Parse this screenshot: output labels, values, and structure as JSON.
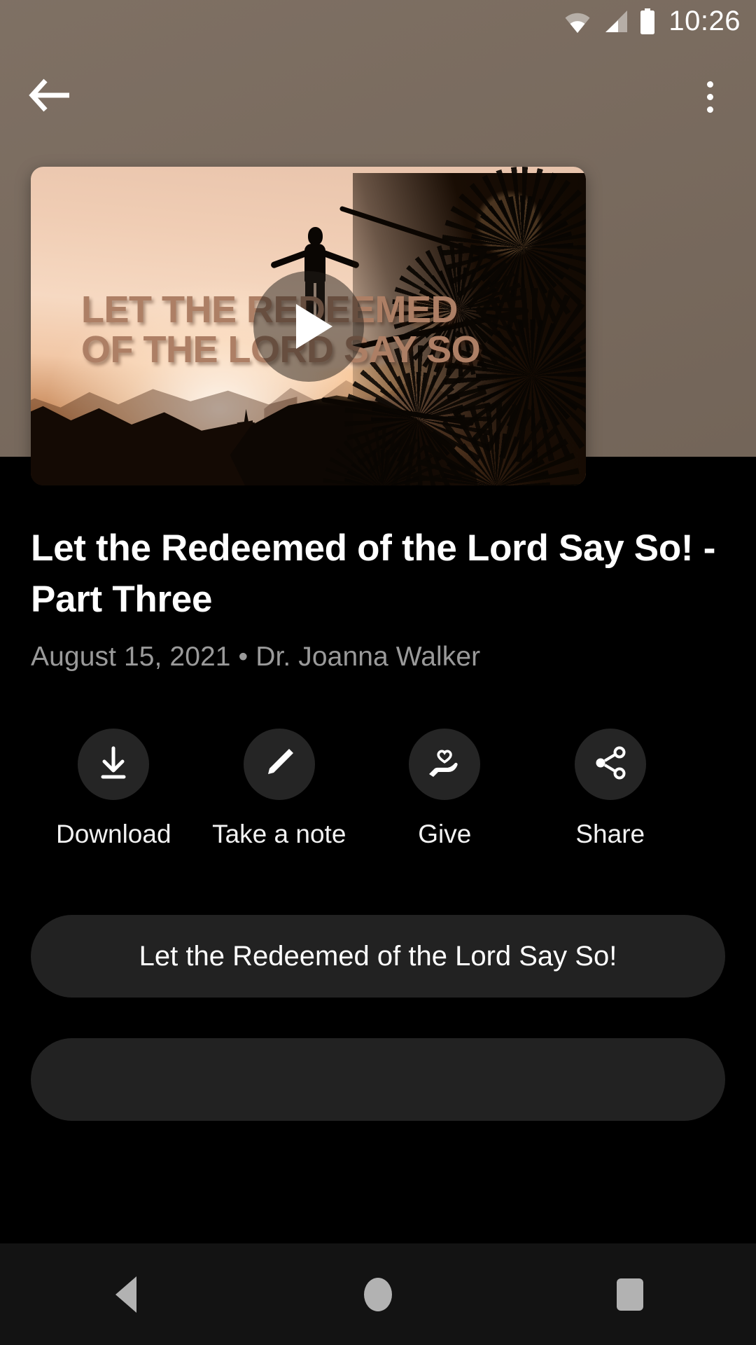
{
  "status_bar": {
    "clock": "10:26",
    "icons": [
      "wifi-icon",
      "cellular-signal-icon",
      "battery-full-icon"
    ]
  },
  "app_bar": {
    "back_icon": "arrow-left-icon",
    "overflow_icon": "more-vertical-icon",
    "background_color": "#7a6b5e"
  },
  "video": {
    "play_icon": "play-icon",
    "overlay_line_1": "LET THE REDEEMED",
    "overlay_line_2": "OF THE LORD SAY SO",
    "overlay_text_color": "#ad7f65",
    "artwork_alt": "silhouette of person with arms outstretched on cliff at sunset with pine trees"
  },
  "details": {
    "title": "Let the Redeemed of the Lord Say So! - Part Three",
    "meta": "August 15, 2021 • Dr. Joanna Walker",
    "date": "August 15, 2021",
    "speaker": "Dr. Joanna Walker"
  },
  "actions": [
    {
      "label": "Download",
      "icon": "download-icon"
    },
    {
      "label": "Take a note",
      "icon": "pencil-icon"
    },
    {
      "label": "Give",
      "icon": "hand-heart-icon"
    },
    {
      "label": "Share",
      "icon": "share-icon"
    }
  ],
  "chips": [
    {
      "label": "Let the Redeemed of the Lord Say So!"
    },
    {
      "label": ""
    }
  ],
  "nav_bar": {
    "back": "nav-back-icon",
    "home": "nav-home-icon",
    "recents": "nav-recents-icon",
    "background_color": "#131313",
    "icon_color": "#b2b2b2"
  },
  "theme": {
    "page_background": "#000000",
    "surface": "#222222",
    "accent_brown": "#7a6b5e",
    "text_primary": "#ffffff",
    "text_secondary": "#9a9a9a"
  }
}
